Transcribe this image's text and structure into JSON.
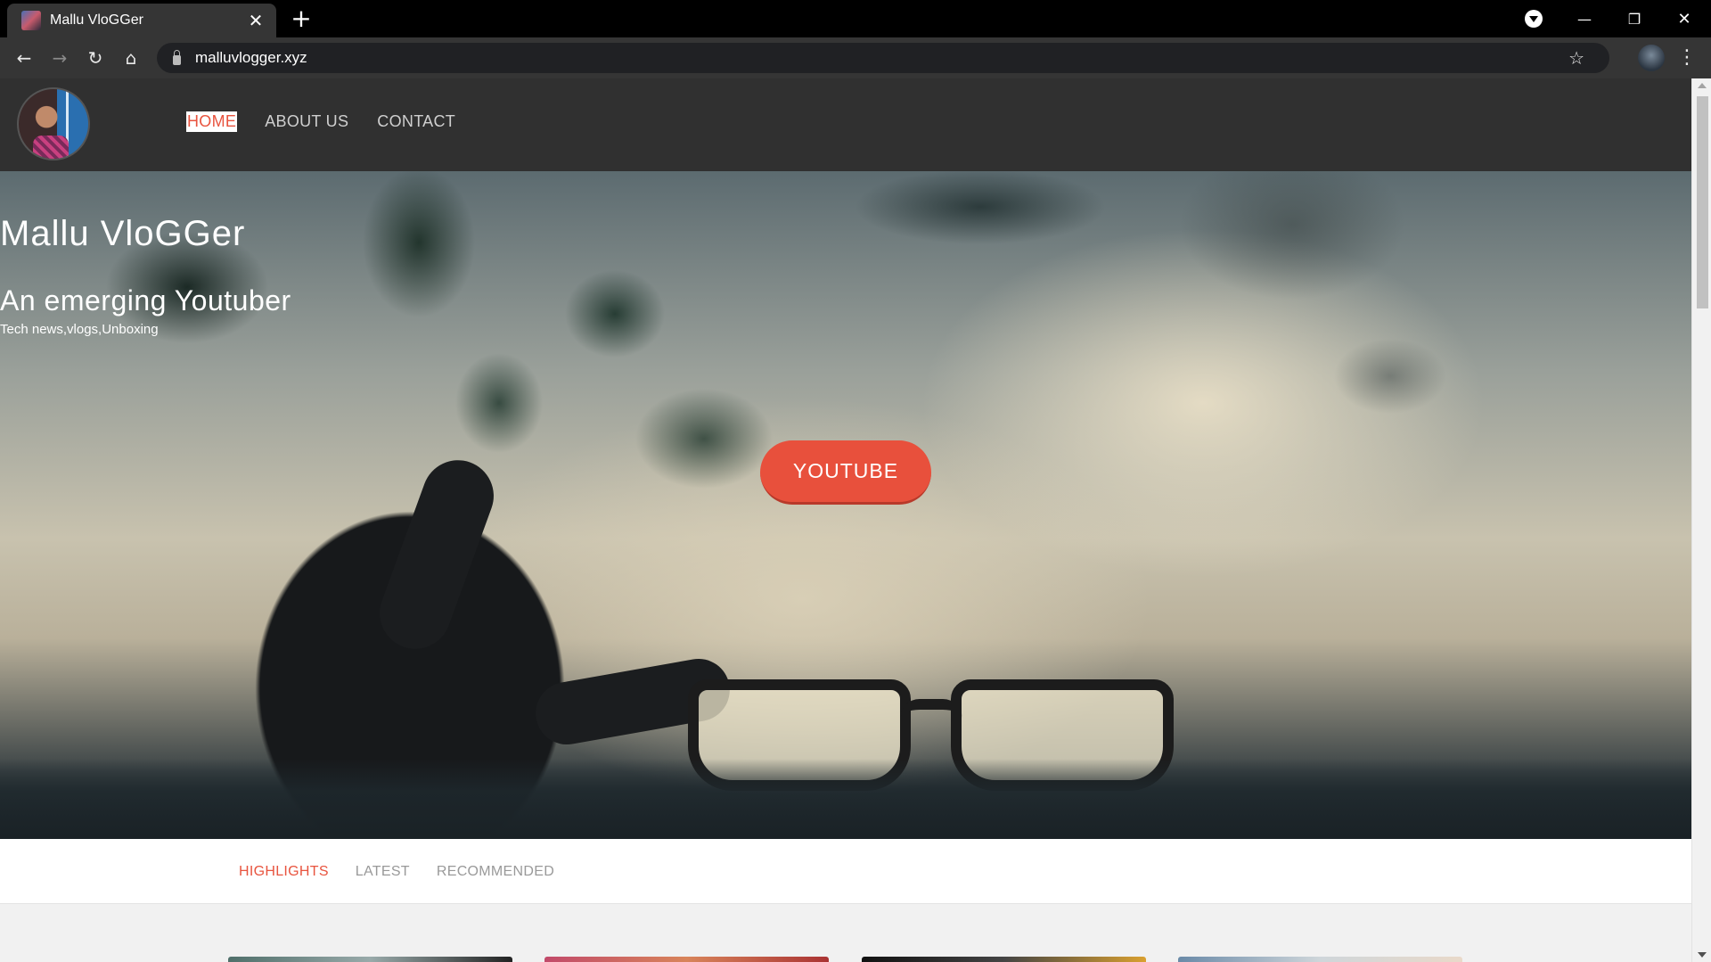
{
  "browser": {
    "tab_title": "Mallu VloGGer",
    "tab_close": "✕",
    "new_tab": "+",
    "url": "malluvlogger.xyz",
    "back": "←",
    "forward": "→",
    "reload": "↻",
    "home": "⌂",
    "star": "☆",
    "menu": "⋮",
    "minimize": "—",
    "restore": "❐",
    "close": "✕"
  },
  "site": {
    "nav": [
      "HOME",
      "ABOUT US",
      "CONTACT"
    ],
    "active_nav": "HOME",
    "accent_color": "#e8543f"
  },
  "hero": {
    "title": "Mallu VloGGer",
    "subtitle": "An emerging Youtuber",
    "tags": "Tech news,vlogs,Unboxing",
    "button": "YOUTUBE"
  },
  "tabs": {
    "items": [
      "HIGHLIGHTS",
      "LATEST",
      "RECOMMENDED"
    ],
    "active": "HIGHLIGHTS"
  }
}
